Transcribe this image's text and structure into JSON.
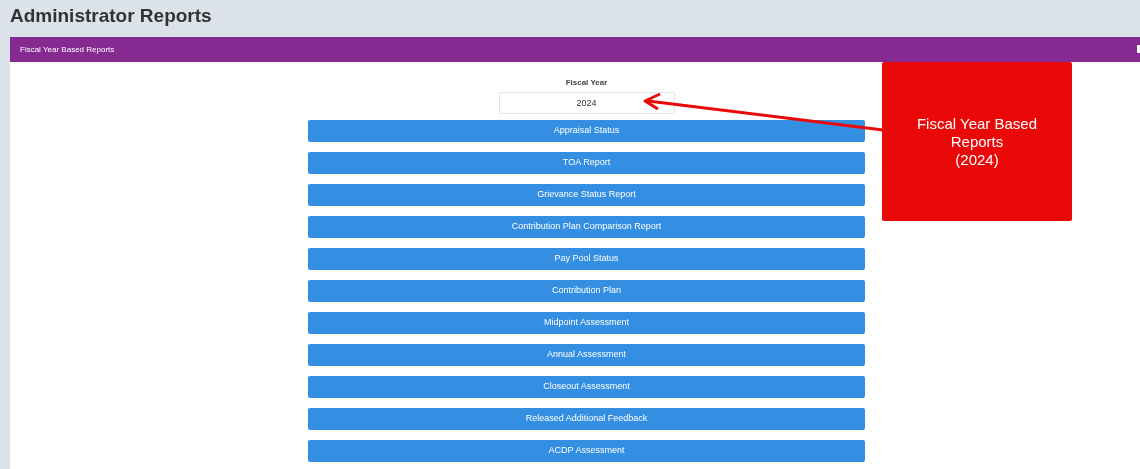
{
  "page": {
    "title": "Administrator Reports"
  },
  "panel": {
    "title": "Fiscal Year Based Reports"
  },
  "fiscal_year": {
    "label": "Fiscal Year",
    "value": "2024"
  },
  "reports": [
    "Appraisal Status",
    "TOA Report",
    "Grievance Status Report",
    "Contribution Plan Comparison Report",
    "Pay Pool Status",
    "Contribution Plan",
    "Midpoint Assessment",
    "Annual Assessment",
    "Closeout Assessment",
    "Released Additional Feedback",
    "ACDP Assessment"
  ],
  "callout": {
    "lines": [
      "Fiscal Year Based",
      "Reports",
      "(2024)"
    ]
  }
}
